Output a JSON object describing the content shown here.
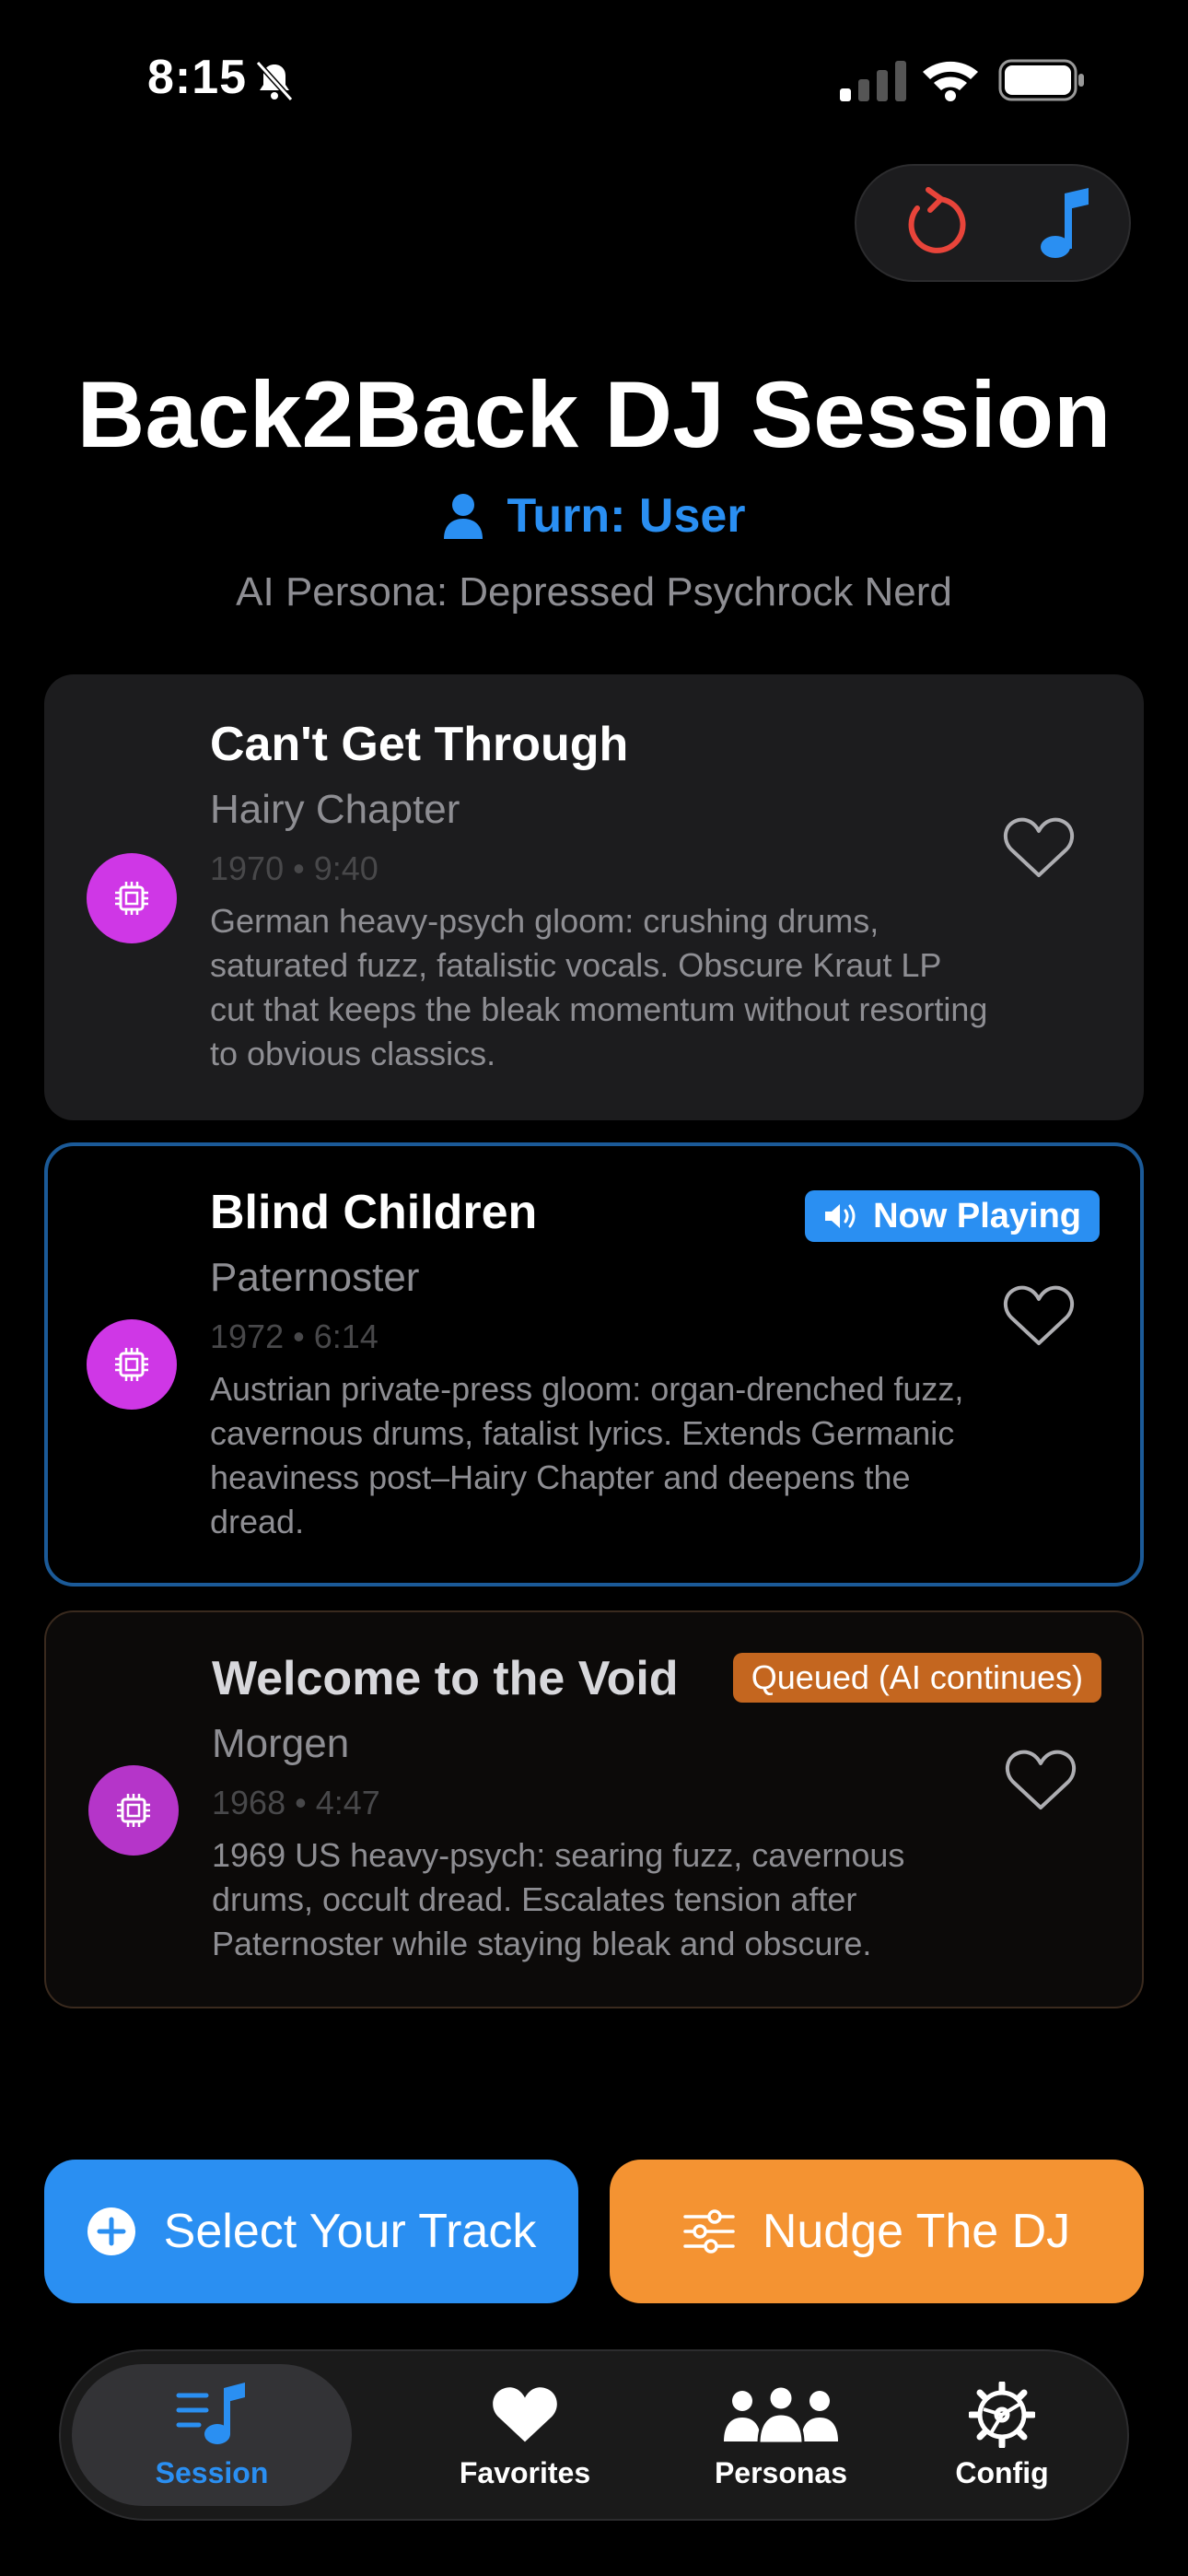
{
  "status_bar": {
    "time": "8:15"
  },
  "header": {
    "title": "Back2Back DJ Session",
    "turn": "Turn: User",
    "persona": "AI Persona: Depressed Psychrock Nerd"
  },
  "tracks": [
    {
      "title": "Can't Get Through",
      "artist": "Hairy Chapter",
      "meta": "1970 • 9:40",
      "description": "German heavy-psych gloom: crushing drums, saturated fuzz, fatalistic vocals. Obscure Kraut LP cut that keeps the bleak momentum without resorting to obvious classics."
    },
    {
      "title": "Blind Children",
      "artist": "Paternoster",
      "meta": "1972 • 6:14",
      "badge": "Now Playing",
      "description": "Austrian private-press gloom: organ-drenched fuzz, cavernous drums, fatalist lyrics. Extends Germanic heaviness post–Hairy Chapter and deepens the dread."
    },
    {
      "title": "Welcome to the Void",
      "artist": "Morgen",
      "meta": "1968 • 4:47",
      "badge": "Queued (AI continues)",
      "description": "1969 US heavy-psych: searing fuzz, cavernous drums, occult dread. Escalates tension after Paternoster while staying bleak and obscure."
    }
  ],
  "actions": {
    "select": "Select Your Track",
    "nudge": "Nudge The DJ"
  },
  "tabs": [
    {
      "label": "Session",
      "icon": "music-list-icon",
      "active": true
    },
    {
      "label": "Favorites",
      "icon": "heart-fill-icon"
    },
    {
      "label": "Personas",
      "icon": "people-icon"
    },
    {
      "label": "Config",
      "icon": "gear-icon"
    }
  ],
  "colors": {
    "accent": "#2a8ff2",
    "orange": "#f49332",
    "ai_chip": "#cf37e6",
    "reset": "#e8443a",
    "queued_badge": "#c4661f"
  }
}
